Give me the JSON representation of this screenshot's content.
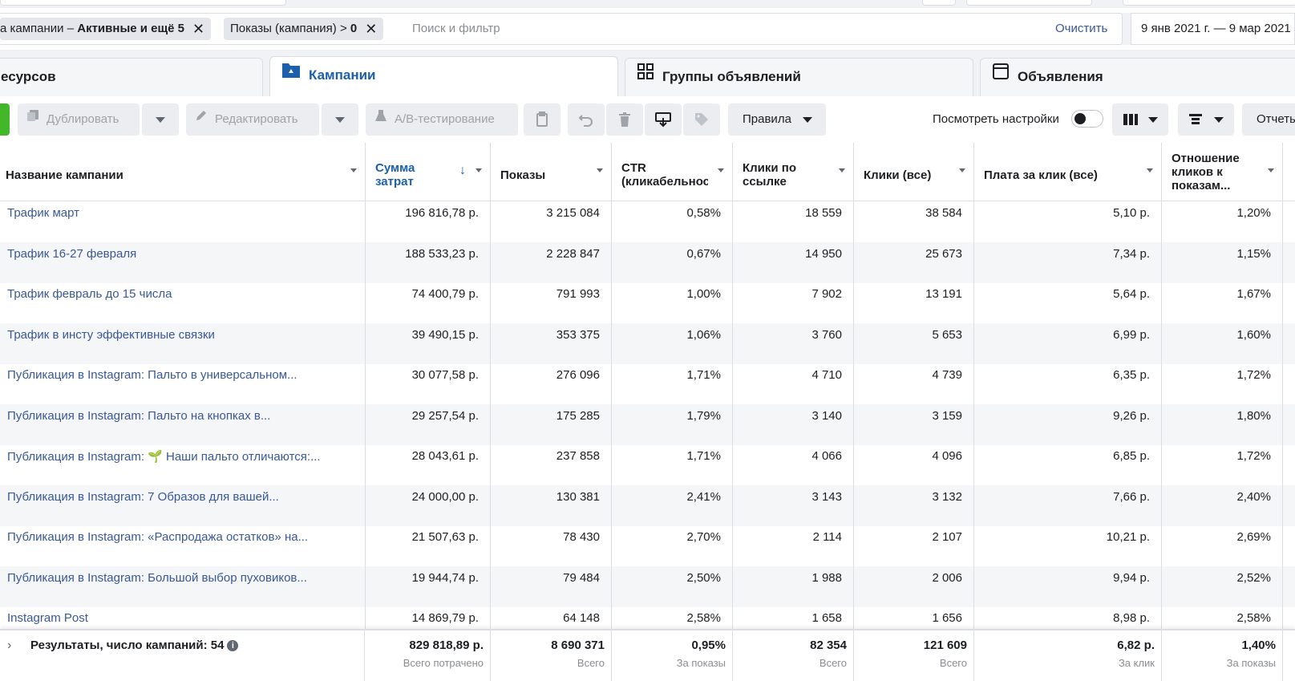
{
  "filters": {
    "chips": [
      {
        "prefix": "а кампании – ",
        "bold": "Активные и ещё 5"
      },
      {
        "prefix": "Показы (кампания) > ",
        "bold": "0"
      }
    ],
    "placeholder": "Поиск и фильтр",
    "clear_label": "Очистить",
    "date_range": "9 янв 2021 г. — 9 мар 2021"
  },
  "tabs": [
    {
      "label": "есурсов"
    },
    {
      "label": "Кампании"
    },
    {
      "label": "Группы объявлений"
    },
    {
      "label": "Объявления"
    }
  ],
  "toolbar": {
    "duplicate": "Дублировать",
    "edit": "Редактировать",
    "ab_test": "A/B-тестирование",
    "rules": "Правила",
    "view_settings": "Посмотреть настройки",
    "reports": "Отчеты"
  },
  "columns": [
    {
      "label": "Название кампании"
    },
    {
      "label": "Сумма затрат"
    },
    {
      "label": "Показы"
    },
    {
      "label": "CTR (кликабельность)"
    },
    {
      "label": "Клики по ссылке"
    },
    {
      "label": "Клики (все)"
    },
    {
      "label": "Плата за клик (все)"
    },
    {
      "label": "Отношение кликов к показам..."
    }
  ],
  "rows": [
    {
      "name": "Трафик март",
      "spend": "196 816,78 р.",
      "impressions": "3 215 084",
      "ctr": "0,58%",
      "link_clicks": "18 559",
      "clicks_all": "38 584",
      "cpc_all": "5,10 р.",
      "ctr_all": "1,20%"
    },
    {
      "name": "Трафик 16-27 февраля",
      "spend": "188 533,23 р.",
      "impressions": "2 228 847",
      "ctr": "0,67%",
      "link_clicks": "14 950",
      "clicks_all": "25 673",
      "cpc_all": "7,34 р.",
      "ctr_all": "1,15%"
    },
    {
      "name": "Трафик февраль до 15 числа",
      "spend": "74 400,79 р.",
      "impressions": "791 993",
      "ctr": "1,00%",
      "link_clicks": "7 902",
      "clicks_all": "13 191",
      "cpc_all": "5,64 р.",
      "ctr_all": "1,67%"
    },
    {
      "name": "Трафик в инсту эффективные связки",
      "spend": "39 490,15 р.",
      "impressions": "353 375",
      "ctr": "1,06%",
      "link_clicks": "3 760",
      "clicks_all": "5 653",
      "cpc_all": "6,99 р.",
      "ctr_all": "1,60%"
    },
    {
      "name": "Публикация в Instagram: Пальто в универсальном...",
      "spend": "30 077,58 р.",
      "impressions": "276 096",
      "ctr": "1,71%",
      "link_clicks": "4 710",
      "clicks_all": "4 739",
      "cpc_all": "6,35 р.",
      "ctr_all": "1,72%"
    },
    {
      "name": "Публикация в Instagram: Пальто на кнопках в...",
      "spend": "29 257,54 р.",
      "impressions": "175 285",
      "ctr": "1,79%",
      "link_clicks": "3 140",
      "clicks_all": "3 159",
      "cpc_all": "9,26 р.",
      "ctr_all": "1,80%"
    },
    {
      "name": "Публикация в Instagram: 🌱 Наши пальто отличаются:...",
      "spend": "28 043,61 р.",
      "impressions": "237 858",
      "ctr": "1,71%",
      "link_clicks": "4 066",
      "clicks_all": "4 096",
      "cpc_all": "6,85 р.",
      "ctr_all": "1,72%"
    },
    {
      "name": "Публикация в Instagram: 7 Образов для вашей...",
      "spend": "24 000,00 р.",
      "impressions": "130 381",
      "ctr": "2,41%",
      "link_clicks": "3 143",
      "clicks_all": "3 132",
      "cpc_all": "7,66 р.",
      "ctr_all": "2,40%"
    },
    {
      "name": "Публикация в Instagram: «Распродажа остатков» на...",
      "spend": "21 507,63 р.",
      "impressions": "78 430",
      "ctr": "2,70%",
      "link_clicks": "2 114",
      "clicks_all": "2 107",
      "cpc_all": "10,21 р.",
      "ctr_all": "2,69%"
    },
    {
      "name": "Публикация в Instagram: Большой выбор пуховиков...",
      "spend": "19 944,74 р.",
      "impressions": "79 484",
      "ctr": "2,50%",
      "link_clicks": "1 988",
      "clicks_all": "2 006",
      "cpc_all": "9,94 р.",
      "ctr_all": "2,52%"
    },
    {
      "name": "Instagram Post",
      "spend": "14 869,79 р.",
      "impressions": "64 148",
      "ctr": "2,58%",
      "link_clicks": "1 658",
      "clicks_all": "1 656",
      "cpc_all": "8,98 р.",
      "ctr_all": "2,58%"
    }
  ],
  "footer": {
    "title": "Результаты, число кампаний: 54",
    "spend": {
      "value": "829 818,89 р.",
      "sub": "Всего потрачено"
    },
    "impressions": {
      "value": "8 690 371",
      "sub": "Всего"
    },
    "ctr": {
      "value": "0,95%",
      "sub": "За показы"
    },
    "link_clicks": {
      "value": "82 354",
      "sub": "Всего"
    },
    "clicks_all": {
      "value": "121 609",
      "sub": "Всего"
    },
    "cpc_all": {
      "value": "6,82 р.",
      "sub": "За клик"
    },
    "ctr_all": {
      "value": "1,40%",
      "sub": "За показы"
    }
  }
}
